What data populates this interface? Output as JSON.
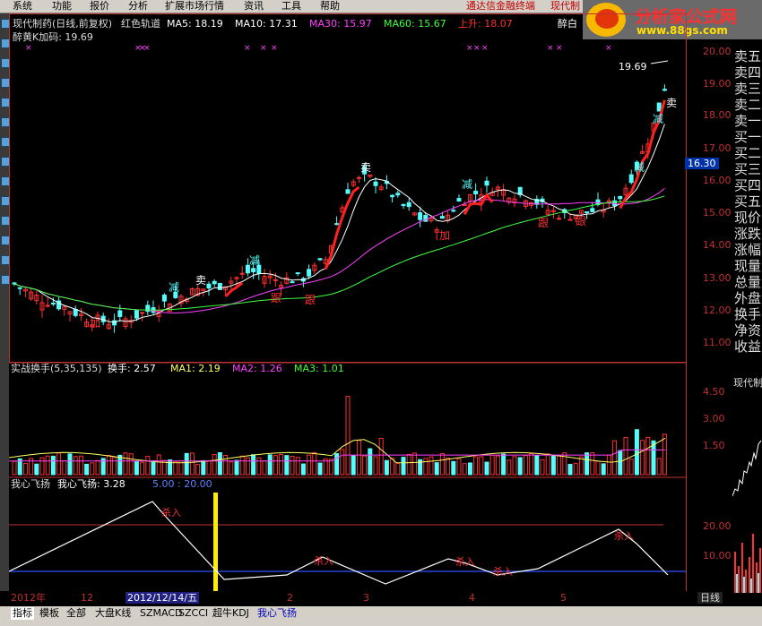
{
  "menubar": {
    "items": [
      "系统",
      "功能",
      "报价",
      "分析",
      "扩展市场行情",
      "资讯",
      "工具",
      "帮助"
    ],
    "promo": "通达信金融终端",
    "stock_name": "现代制"
  },
  "logo": {
    "title": "分析家公式网",
    "url": "www.88gs.com"
  },
  "main_header": {
    "stock": "现代制药(日线,前复权)",
    "indicator": "红色轨道",
    "ma5": "MA5: 18.19",
    "ma10": "MA10: 17.31",
    "ma30": "MA30: 15.97",
    "ma60": "MA60: 15.67",
    "up": "上升: 18.07",
    "extra": "醉白",
    "line2": "醉黄K加码: 19.69",
    "peak_label": "19.69"
  },
  "price_axis": [
    "20.00",
    "19.00",
    "18.00",
    "17.00",
    "16.00",
    "15.00",
    "14.00",
    "13.00",
    "12.00",
    "11.00"
  ],
  "current_price": "16.30",
  "signals": {
    "sell": "卖",
    "reduce": "减",
    "add": "加",
    "follow": "跟"
  },
  "volume_header": {
    "title": "实战换手(5,35,135)",
    "turnover": "换手: 2.57",
    "ma1": "MA1: 2.19",
    "ma2": "MA2: 1.26",
    "ma3": "MA3: 1.01"
  },
  "volume_axis": [
    "4.50",
    "3.00",
    "1.50"
  ],
  "osc_header": {
    "title": "我心飞扬",
    "value": "我心飞扬: 3.28",
    "levels": "5.00 : 20.00"
  },
  "osc_axis": [
    "20.00",
    "10.00"
  ],
  "osc_signal": "杀入",
  "date_axis": {
    "year": "2012年",
    "m12": "12",
    "cursor_date": "2012/12/14/五",
    "m2": "2",
    "m3": "3",
    "m4": "4",
    "m5": "5",
    "period": "日线"
  },
  "right_panel": {
    "labels": [
      "卖五",
      "卖四",
      "卖三",
      "卖二",
      "卖一",
      "买一",
      "买二",
      "买三",
      "买四",
      "买五",
      "现价",
      "涨跌",
      "涨幅",
      "现量",
      "总量",
      "外盘",
      "换手",
      "净资",
      "收益"
    ],
    "mini_chart_title": "现代制"
  },
  "tabs": [
    "指标",
    "模板",
    "全部",
    "大盘K线",
    "SZMACD",
    "SZCCI",
    "超牛KDJ",
    "我心飞扬"
  ],
  "colors": {
    "up": "#ff3030",
    "down": "#54fcfc",
    "ma5": "#ffffff",
    "ma30": "#ff00ff",
    "ma60": "#00ff00",
    "axis": "#c03030"
  }
}
